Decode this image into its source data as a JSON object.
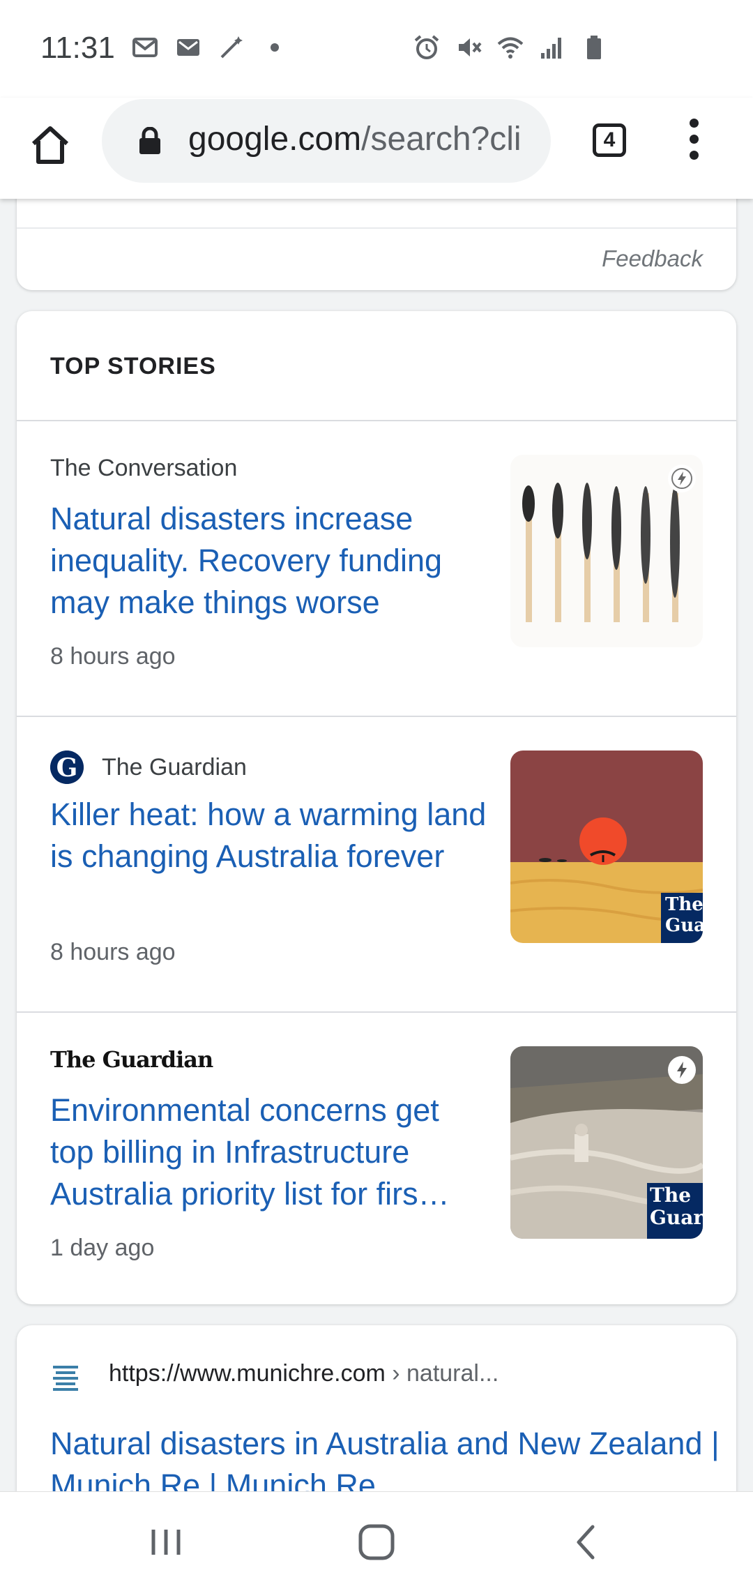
{
  "status_bar": {
    "time": "11:31",
    "left_icons": [
      "mail-icon",
      "gmail-icon",
      "magic-wand-icon",
      "dot-icon"
    ],
    "right_icons": [
      "alarm-icon",
      "mute-icon",
      "wifi-icon",
      "signal-icon",
      "battery-icon"
    ]
  },
  "browser": {
    "url_host": "google.com",
    "url_rest": "/search?cli",
    "tab_count": "4"
  },
  "feedback_card": {
    "feedback_label": "Feedback"
  },
  "top_stories": {
    "header": "TOP STORIES",
    "items": [
      {
        "source": "The Conversation",
        "title": "Natural disasters increase inequality. Recovery funding may make things worse",
        "time": "8 hours ago",
        "amp": true
      },
      {
        "source": "The Guardian",
        "title": "Killer heat: how a warming land is changing Australia forever",
        "time": "8 hours ago",
        "thumb_wordmark": "The Gua"
      },
      {
        "source": "The Guardian",
        "title": "Environmental concerns get top billing in Infrastructure Australia priority list for firs…",
        "time": "1 day ago",
        "thumb_wordmark": "The Guard",
        "amp": true
      }
    ]
  },
  "result": {
    "url": "https://www.munichre.com",
    "breadcrumb": " › natural...",
    "title": "Natural disasters in Australia and New Zealand | Munich Re | Munich Re"
  },
  "colors": {
    "link_blue": "#1a5fb4",
    "guardian_navy": "#052962",
    "sunset_sky": "#8b4444",
    "sand": "#e6b450"
  }
}
